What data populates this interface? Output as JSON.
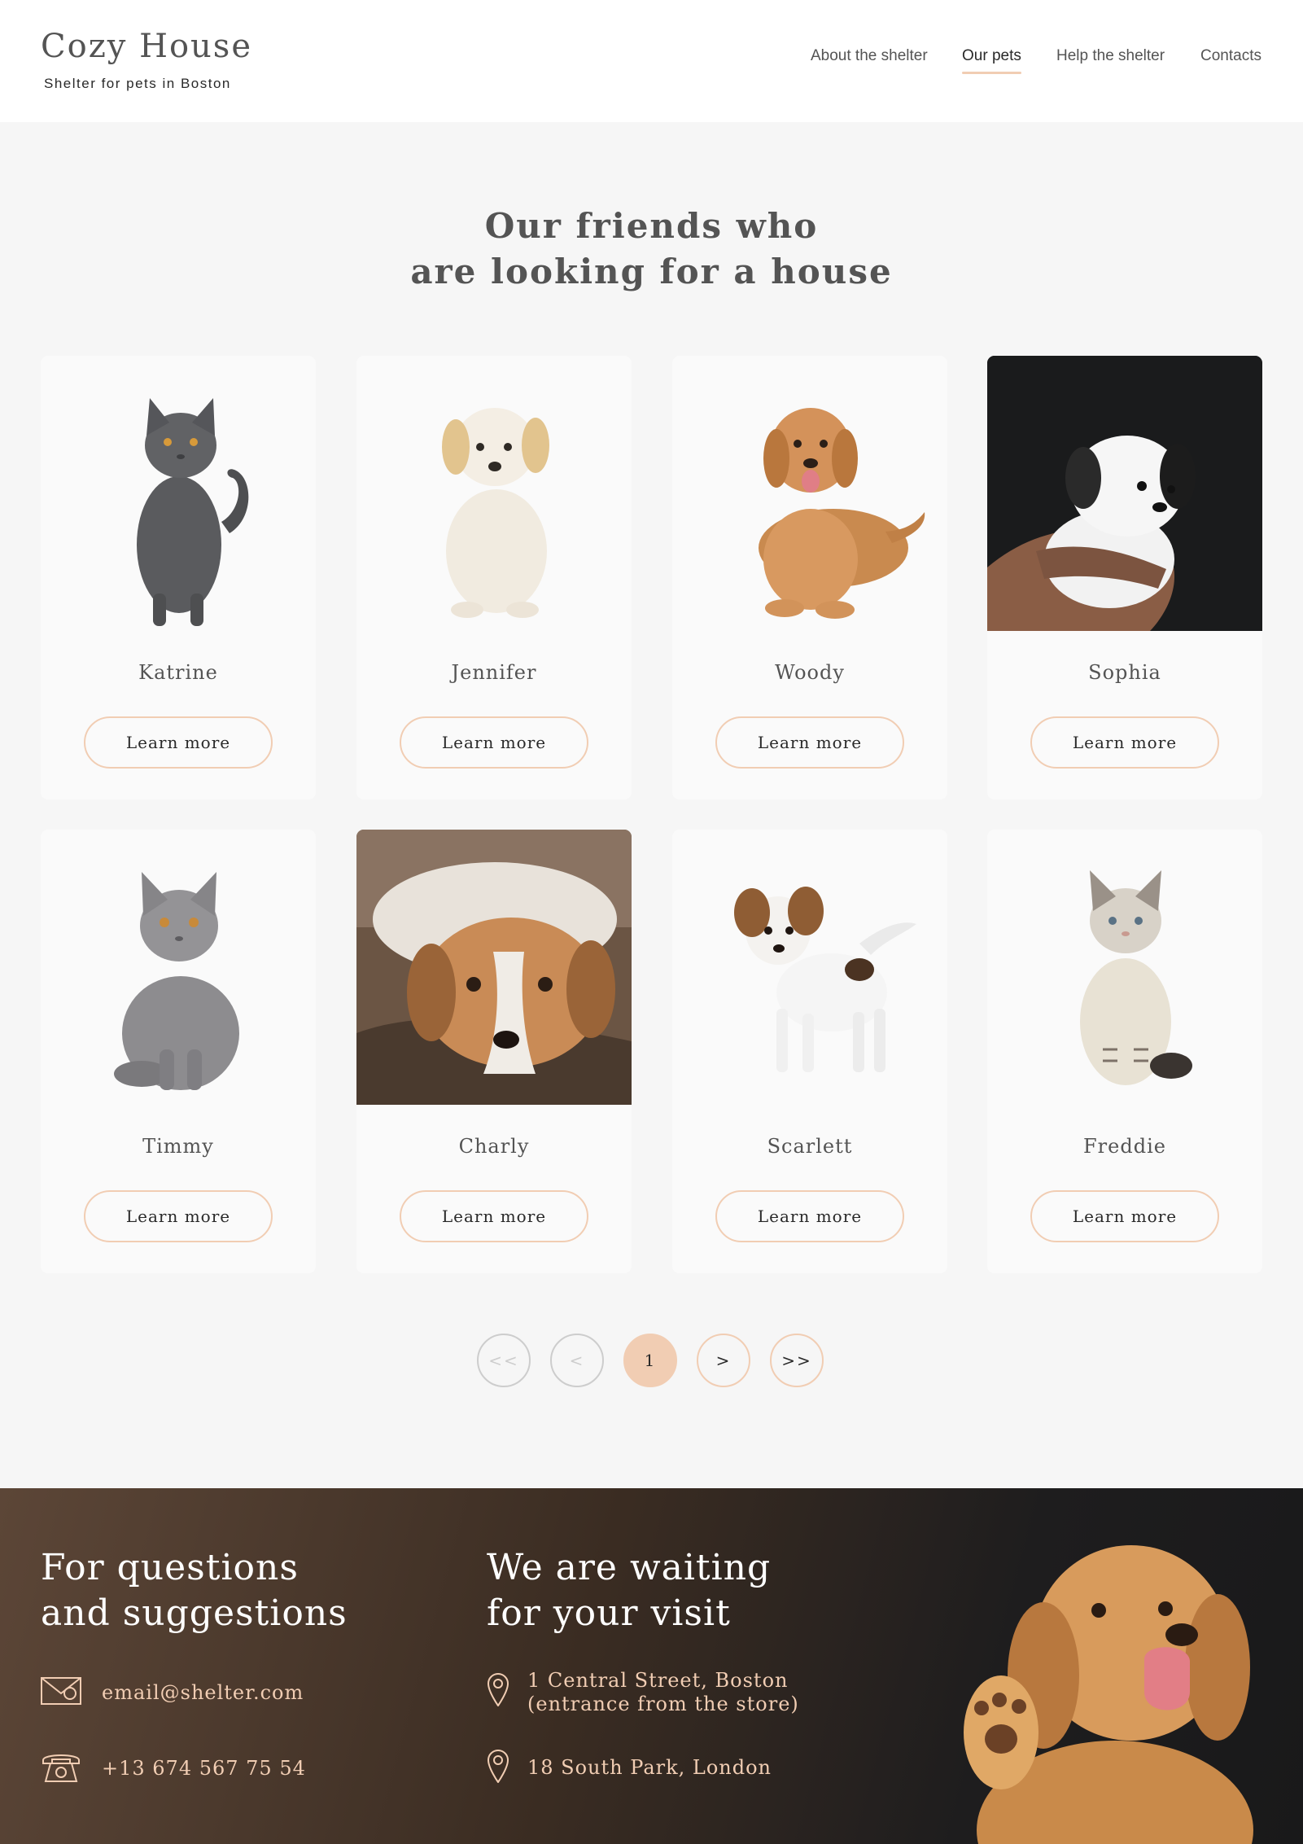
{
  "header": {
    "logo_title": "Cozy House",
    "logo_subtitle": "Shelter for pets in Boston",
    "nav": [
      {
        "label": "About the shelter",
        "active": false
      },
      {
        "label": "Our pets",
        "active": true
      },
      {
        "label": "Help the shelter",
        "active": false
      },
      {
        "label": "Contacts",
        "active": false
      }
    ]
  },
  "pets_section": {
    "title_line1": "Our friends who",
    "title_line2": "are looking for a house",
    "pets": [
      {
        "name": "Katrine",
        "photo": "grey-cat-icon",
        "button": "Learn more"
      },
      {
        "name": "Jennifer",
        "photo": "cream-puppy-icon",
        "button": "Learn more"
      },
      {
        "name": "Woody",
        "photo": "golden-retriever-icon",
        "button": "Learn more"
      },
      {
        "name": "Sophia",
        "photo": "black-white-puppy-icon",
        "button": "Learn more"
      },
      {
        "name": "Timmy",
        "photo": "grey-cat-sitting-icon",
        "button": "Learn more"
      },
      {
        "name": "Charly",
        "photo": "brown-white-dog-icon",
        "button": "Learn more"
      },
      {
        "name": "Scarlett",
        "photo": "jack-russell-puppy-icon",
        "button": "Learn more"
      },
      {
        "name": "Freddie",
        "photo": "tabby-kitten-icon",
        "button": "Learn more"
      }
    ]
  },
  "pagination": {
    "first": "<<",
    "prev": "<",
    "current": "1",
    "next": ">",
    "last": ">>"
  },
  "footer": {
    "questions_title_line1": "For questions",
    "questions_title_line2": "and suggestions",
    "email": "email@shelter.com",
    "phone": "+13 674 567 75 54",
    "visit_title_line1": "We are waiting",
    "visit_title_line2": "for your visit",
    "address1_line1": "1 Central Street, Boston",
    "address1_line2": "(entrance from the store)",
    "address2": "18 South Park, London",
    "puppy_image": "golden-puppy-paw-icon"
  },
  "colors": {
    "accent": "#f1cdb3",
    "text": "#545454",
    "dark": "#292929",
    "page_bg": "#f6f6f6",
    "card_bg": "#fafafa"
  }
}
